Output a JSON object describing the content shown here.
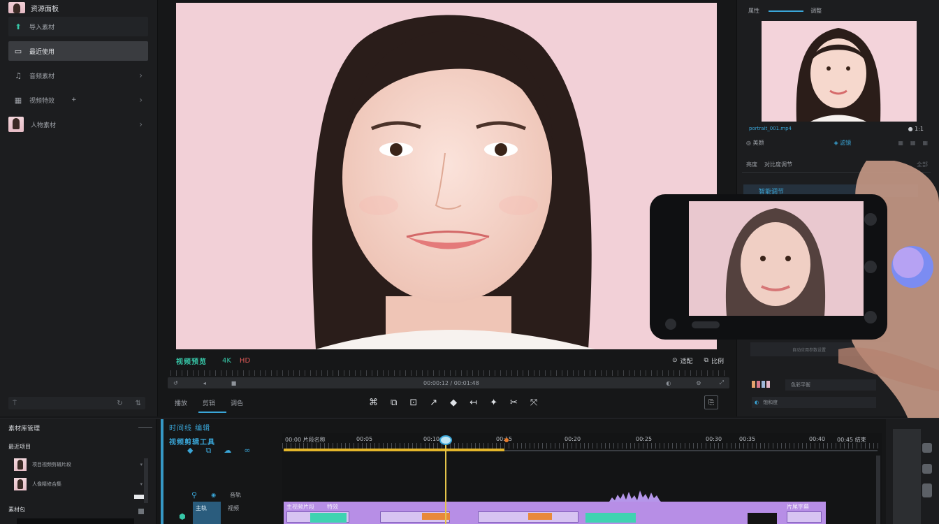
{
  "left_panel": {
    "header": "资源面板",
    "nav": [
      {
        "label": "导入素材",
        "icon": "import-icon"
      },
      {
        "label": "最近使用",
        "icon": "recent-icon"
      },
      {
        "label": "音频素材",
        "icon": "audio-icon"
      },
      {
        "label": "视频特效",
        "icon": "effects-icon"
      },
      {
        "label": "人物素材",
        "icon": "portrait-icon"
      }
    ]
  },
  "preview": {
    "title": "视频预览",
    "tag_a": "4K",
    "tag_b": "HD",
    "right_controls": [
      "适配",
      "比例"
    ],
    "scrub_text": "00:00:12 / 00:01:48",
    "tabs": [
      "播放",
      "剪辑",
      "调色"
    ],
    "tools": [
      "⌘",
      "⧉",
      "⊡",
      "↗",
      "◆",
      "↤",
      "✦",
      "✂",
      "⤧"
    ]
  },
  "right_panel": {
    "tab_a": "属性",
    "tab_b": "调整",
    "meta_left": "portrait_001.mp4",
    "meta_right": "● 1:1",
    "row1_a": "◎ 美颜",
    "row1_b": "◈ 滤镜",
    "row2_a": "亮度",
    "row2_b": "对比度调节",
    "row2_c": "全部",
    "blue_bar": "智能调节",
    "lower_text": "自动应用参数设置",
    "sel1": "色彩平衡",
    "sel2_a": "◐",
    "sel2_b": "饱和度"
  },
  "library": {
    "title": "素材库管理",
    "subtitle": "最近项目",
    "items": [
      "项目视频剪辑片段",
      "人像精修合集"
    ],
    "footer": "素材包"
  },
  "timeline": {
    "title": "时间线 编辑",
    "subtitle": "视频剪辑工具",
    "ruler": [
      "00:00 片段名称",
      "00:05",
      "00:10",
      "00:15",
      "00:20",
      "00:25",
      "00:30",
      "00:35",
      "00:40",
      "00:45 结束"
    ],
    "track_labels": [
      "音轨",
      "视频"
    ],
    "blue_block": "主轨",
    "clip_labels": [
      "主视频片段",
      "特效"
    ],
    "clip_end": "片尾字幕"
  },
  "colors": {
    "accent_blue": "#3aa6d8",
    "accent_green": "#37c7a8",
    "clip_purple": "#b78ee6",
    "playhead": "#e4c44a"
  }
}
